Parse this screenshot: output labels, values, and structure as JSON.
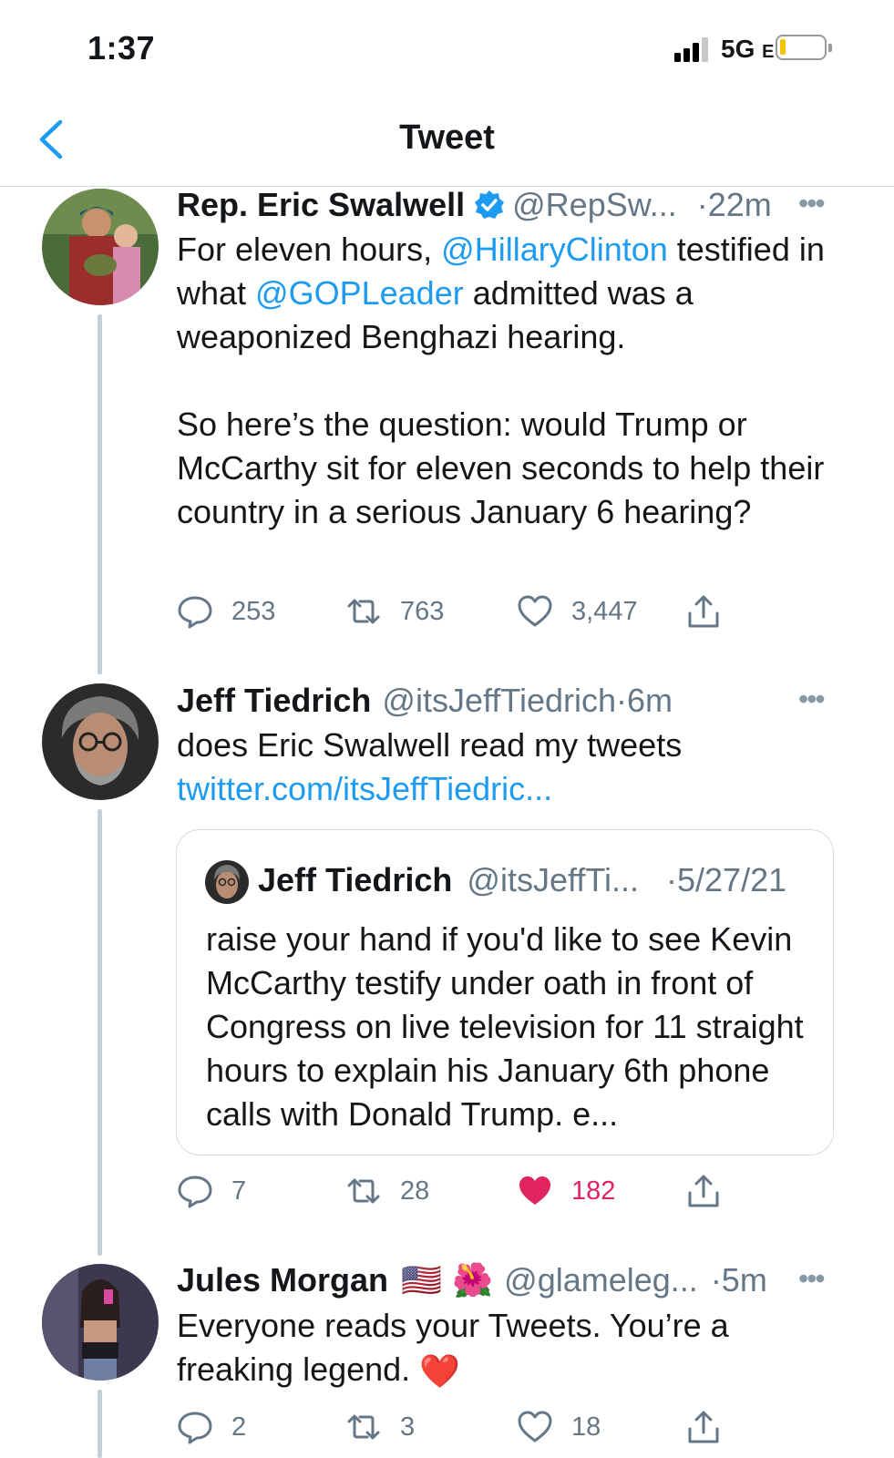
{
  "status_bar": {
    "time": "1:37",
    "network": "5G",
    "network_suffix": "E"
  },
  "nav": {
    "title": "Tweet"
  },
  "tweets": [
    {
      "name": "Rep. Eric Swalwell",
      "handle": "@RepSw...",
      "time": "·22m",
      "text_parts": [
        "For eleven hours, ",
        "@HillaryClinton",
        " testified in what ",
        "@GOPLeader",
        " admitted was a weaponized Benghazi hearing."
      ],
      "text_2": "So here’s the question: would Trump or McCarthy sit for eleven seconds to help their country in a serious January 6 hearing?",
      "replies": "253",
      "retweets": "763",
      "likes": "3,447"
    },
    {
      "name": "Jeff Tiedrich",
      "handle": "@itsJeffTiedrich",
      "time": "·6m",
      "text": "does Eric Swalwell read my tweets",
      "link": "twitter.com/itsJeffTiedric...",
      "quote": {
        "name": "Jeff Tiedrich",
        "handle": "@itsJeffTi...",
        "time": "·5/27/21",
        "text": "raise your hand if you'd like to see Kevin McCarthy testify under oath in front of Congress on live television for 11 straight hours to explain his January 6th phone calls with Donald Trump. e..."
      },
      "replies": "7",
      "retweets": "28",
      "likes": "182"
    },
    {
      "name": "Jules Morgan",
      "name_emojis": "🇺🇸 🌺",
      "handle": "@glameleg...",
      "time": "·5m",
      "text": "Everyone reads your Tweets. You’re a freaking legend.",
      "text_emoji": "❤️",
      "replies": "2",
      "retweets": "3",
      "likes": "18"
    }
  ],
  "colors": {
    "accent": "#1d9bf0",
    "like_active": "#e0245e",
    "muted": "#657786"
  }
}
